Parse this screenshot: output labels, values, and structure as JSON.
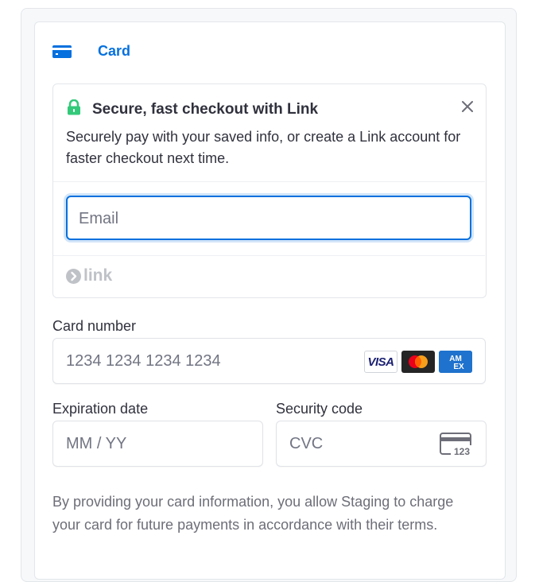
{
  "tab": {
    "label": "Card",
    "icon": "credit-card-icon",
    "accent": "#0570de"
  },
  "link_banner": {
    "title": "Secure, fast checkout with Link",
    "description": "Securely pay with your saved info, or create a Link account for faster checkout next time.",
    "email_placeholder": "Email",
    "logo_text": "link",
    "lock_color": "#33ddb3"
  },
  "card_number": {
    "label": "Card number",
    "placeholder": "1234 1234 1234 1234",
    "brands": [
      "VISA",
      "Mastercard",
      "AMEX"
    ]
  },
  "expiration": {
    "label": "Expiration date",
    "placeholder": "MM / YY"
  },
  "security": {
    "label": "Security code",
    "placeholder": "CVC",
    "icon_text": "123"
  },
  "terms": "By providing your card information, you allow Staging to charge your card for future payments in accordance with their terms."
}
